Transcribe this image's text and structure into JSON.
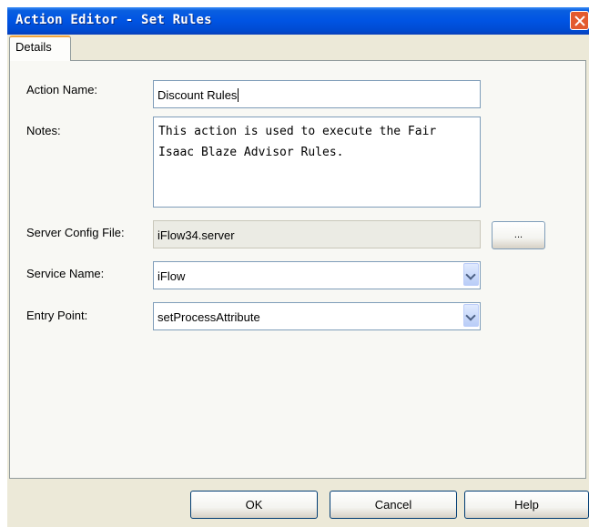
{
  "window": {
    "title": "Action Editor - Set Rules"
  },
  "tabs": [
    {
      "label": "Details"
    }
  ],
  "form": {
    "action_name": {
      "label": "Action Name:",
      "value": "Discount Rules"
    },
    "notes": {
      "label": "Notes:",
      "value": "This action is used to execute the Fair\nIsaac Blaze Advisor Rules."
    },
    "server_config": {
      "label": "Server Config File:",
      "value": "iFlow34.server",
      "browse_label": "..."
    },
    "service_name": {
      "label": "Service Name:",
      "value": "iFlow"
    },
    "entry_point": {
      "label": "Entry Point:",
      "value": "setProcessAttribute"
    }
  },
  "buttons": {
    "ok": "OK",
    "cancel": "Cancel",
    "help": "Help"
  },
  "icons": {
    "close": "close-icon",
    "dropdown": "chevron-down-icon"
  },
  "colors": {
    "titlebar": "#0054e3",
    "tab_highlight": "#f2a43c",
    "close_button": "#e35a2e",
    "dialog_background": "#ece9d8"
  }
}
